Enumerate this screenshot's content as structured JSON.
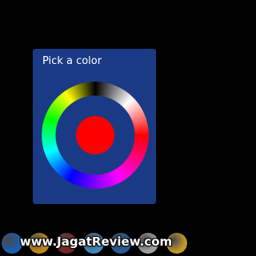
{
  "dialog": {
    "title": "Pick a color"
  },
  "picker": {
    "selected_color": "#ff0000",
    "dialog_background": "#1a3a86"
  },
  "dock": {
    "icons": [
      {
        "name": "globe-icon",
        "color": "#1e6fd0"
      },
      {
        "name": "smiley-icon",
        "color": "#e0a020"
      },
      {
        "name": "app-icon",
        "color": "#8a2b2b"
      },
      {
        "name": "arrow-icon",
        "color": "#4aa0e0"
      },
      {
        "name": "browser-icon",
        "color": "#2a6ab0"
      },
      {
        "name": "settings-icon",
        "color": "#bbbbbb"
      },
      {
        "name": "mail-icon",
        "color": "#e0b030"
      }
    ]
  },
  "watermark": {
    "text": "www.JagatReview.com"
  }
}
